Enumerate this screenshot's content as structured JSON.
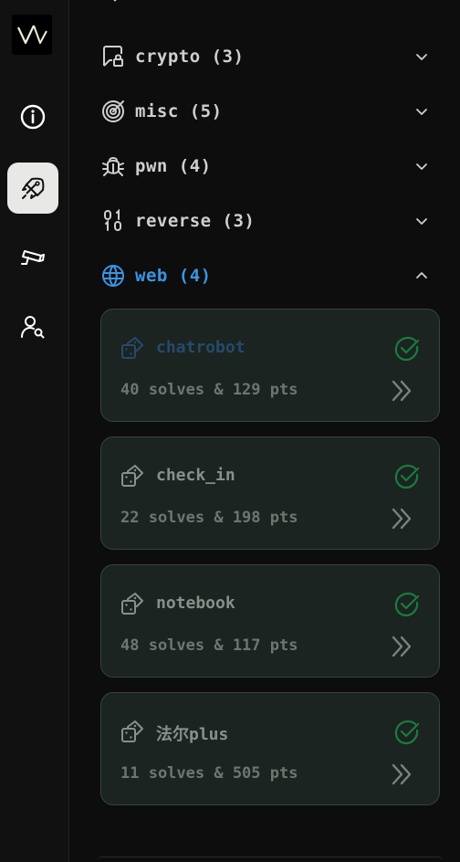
{
  "sidebar": {
    "logo": "VM-logo",
    "nav": [
      {
        "icon": "info-icon",
        "active": false
      },
      {
        "icon": "rocket-icon",
        "active": true
      },
      {
        "icon": "camera-icon",
        "active": false
      },
      {
        "icon": "user-search-icon",
        "active": false
      }
    ]
  },
  "categories": [
    {
      "label": "crypto (3)",
      "icon": "lock-badge-icon",
      "expanded": false
    },
    {
      "label": "misc (5)",
      "icon": "target-icon",
      "expanded": false
    },
    {
      "label": "pwn (4)",
      "icon": "bug-icon",
      "expanded": false
    },
    {
      "label": "reverse (3)",
      "icon": "binary-icon",
      "expanded": false
    },
    {
      "label": "web (4)",
      "icon": "globe-icon",
      "expanded": true
    }
  ],
  "challenges": [
    {
      "title": "chatrobot",
      "stats": "40 solves & 129 pts",
      "solved": true
    },
    {
      "title": "check_in",
      "stats": "22 solves & 198 pts",
      "solved": true
    },
    {
      "title": "notebook",
      "stats": "48 solves & 117 pts",
      "solved": true
    },
    {
      "title": "法尔plus",
      "stats": "11 solves & 505 pts",
      "solved": true
    }
  ],
  "colors": {
    "background": "#0d0d0d",
    "accent_blue": "#3a95e2",
    "card_background": "#1b2420",
    "card_border": "#2e4a3c",
    "solved_green": "#1d7a3e",
    "active_nav": "#e8e8e6"
  }
}
